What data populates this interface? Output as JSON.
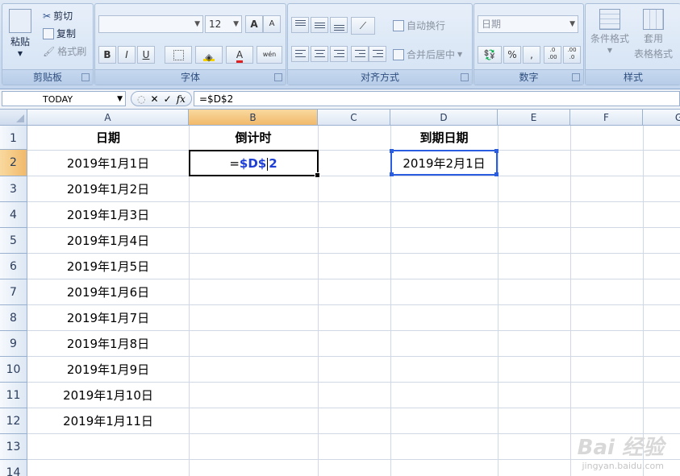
{
  "ribbon": {
    "clipboard": {
      "paste": "粘贴",
      "cut": "剪切",
      "copy": "复制",
      "format_painter": "格式刷",
      "label": "剪贴板"
    },
    "font": {
      "name": "",
      "size": "12",
      "grow": "A",
      "shrink": "A",
      "bold": "B",
      "italic": "I",
      "underline": "U",
      "phonetic": "wén",
      "label": "字体"
    },
    "alignment": {
      "wrap": "自动换行",
      "merge": "合并后居中",
      "label": "对齐方式"
    },
    "number": {
      "format": "日期",
      "percent": "%",
      "comma": ",",
      "inc_decimal": ".0 .00",
      "dec_decimal": ".00 .0",
      "label": "数字"
    },
    "styles": {
      "conditional": "条件格式",
      "apply1": "套用",
      "apply2": "表格格式",
      "label": "样式"
    }
  },
  "formula_bar": {
    "name_box": "TODAY",
    "cancel": "✕",
    "enter": "✓",
    "fx": "fx",
    "formula": "=$D$2"
  },
  "columns": [
    "A",
    "B",
    "C",
    "D",
    "E",
    "F",
    "G"
  ],
  "rows": [
    "1",
    "2",
    "3",
    "4",
    "5",
    "6",
    "7",
    "8",
    "9",
    "10",
    "11",
    "12",
    "13",
    "14"
  ],
  "cells": {
    "A1": "日期",
    "B1": "倒计时",
    "D1": "到期日期",
    "B2_prefix": "=",
    "B2_ref": "$D$",
    "B2_suffix": "2",
    "D2": "2019年2月1日",
    "A_dates": [
      "2019年1月1日",
      "2019年1月2日",
      "2019年1月3日",
      "2019年1月4日",
      "2019年1月5日",
      "2019年1月6日",
      "2019年1月7日",
      "2019年1月8日",
      "2019年1月9日",
      "2019年1月10日",
      "2019年1月11日"
    ]
  },
  "watermark": {
    "brand": "Bai 经验",
    "url": "jingyan.baidu.com"
  }
}
